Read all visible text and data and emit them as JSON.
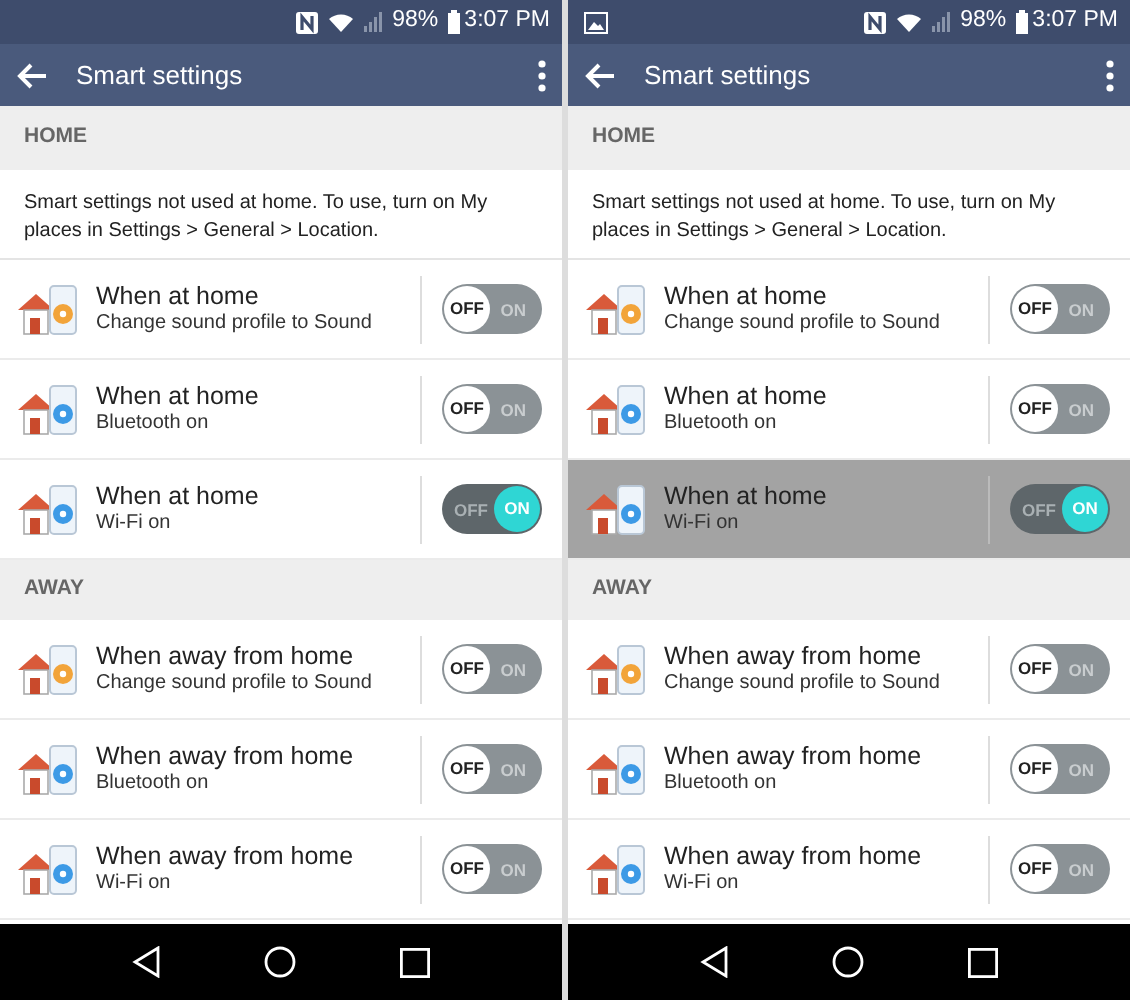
{
  "screens": [
    {
      "status_bar": {
        "battery": "98%",
        "time": "3:07 PM"
      },
      "title": "Smart settings",
      "sections": [
        {
          "header": "HOME",
          "description": "Smart settings not used at home. To use, turn on My places in Settings > General > Location.",
          "items": [
            {
              "kind": "sound",
              "title": "When at home",
              "subtitle": "Change sound profile to Sound",
              "off_label": "OFF",
              "on_label": "ON",
              "on": false,
              "pressed": false
            },
            {
              "kind": "bluetooth",
              "title": "When at home",
              "subtitle": "Bluetooth on",
              "off_label": "OFF",
              "on_label": "ON",
              "on": false,
              "pressed": false
            },
            {
              "kind": "wifi",
              "title": "When at home",
              "subtitle": "Wi-Fi on",
              "off_label": "OFF",
              "on_label": "ON",
              "on": true,
              "pressed": false
            }
          ]
        },
        {
          "header": "AWAY",
          "items": [
            {
              "kind": "sound",
              "title": "When away from home",
              "subtitle": "Change sound profile to Sound",
              "off_label": "OFF",
              "on_label": "ON",
              "on": false,
              "pressed": false
            },
            {
              "kind": "bluetooth",
              "title": "When away from home",
              "subtitle": "Bluetooth on",
              "off_label": "OFF",
              "on_label": "ON",
              "on": false,
              "pressed": false
            },
            {
              "kind": "wifi",
              "title": "When away from home",
              "subtitle": "Wi-Fi on",
              "off_label": "OFF",
              "on_label": "ON",
              "on": false,
              "pressed": false
            }
          ]
        }
      ]
    },
    {
      "status_bar": {
        "notification_icons": [
          {
            "kind": "gallery"
          }
        ],
        "battery": "98%",
        "time": "3:07 PM"
      },
      "title": "Smart settings",
      "sections": [
        {
          "header": "HOME",
          "description": "Smart settings not used at home. To use, turn on My places in Settings > General > Location.",
          "items": [
            {
              "kind": "sound",
              "title": "When at home",
              "subtitle": "Change sound profile to Sound",
              "off_label": "OFF",
              "on_label": "ON",
              "on": false,
              "pressed": false
            },
            {
              "kind": "bluetooth",
              "title": "When at home",
              "subtitle": "Bluetooth on",
              "off_label": "OFF",
              "on_label": "ON",
              "on": false,
              "pressed": false
            },
            {
              "kind": "wifi",
              "title": "When at home",
              "subtitle": "Wi-Fi on",
              "off_label": "OFF",
              "on_label": "ON",
              "on": true,
              "pressed": true
            }
          ]
        },
        {
          "header": "AWAY",
          "items": [
            {
              "kind": "sound",
              "title": "When away from home",
              "subtitle": "Change sound profile to Sound",
              "off_label": "OFF",
              "on_label": "ON",
              "on": false,
              "pressed": false
            },
            {
              "kind": "bluetooth",
              "title": "When away from home",
              "subtitle": "Bluetooth on",
              "off_label": "OFF",
              "on_label": "ON",
              "on": false,
              "pressed": false
            },
            {
              "kind": "wifi",
              "title": "When away from home",
              "subtitle": "Wi-Fi on",
              "off_label": "OFF",
              "on_label": "ON",
              "on": false,
              "pressed": false
            }
          ]
        }
      ]
    }
  ]
}
